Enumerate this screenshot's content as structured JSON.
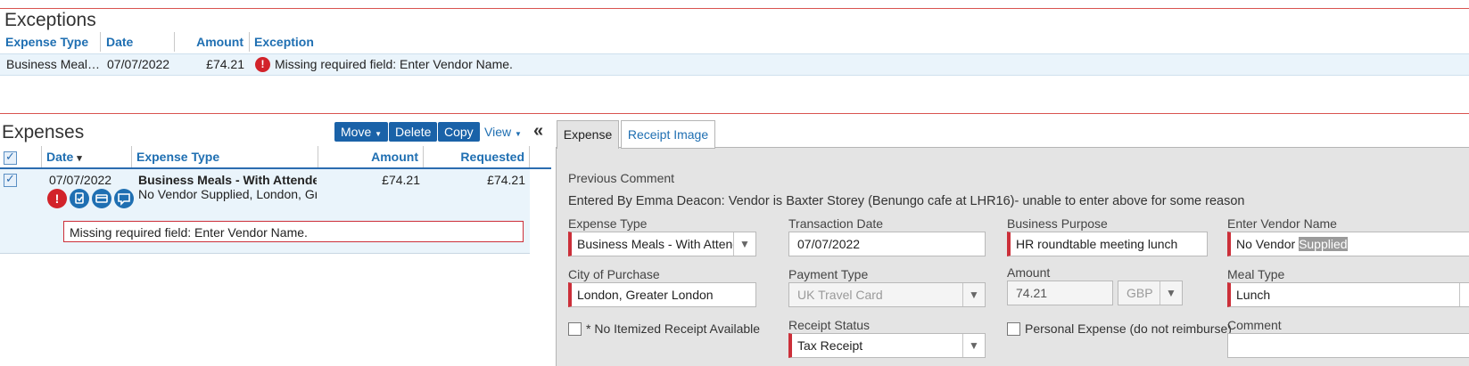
{
  "exceptions": {
    "title": "Exceptions",
    "columns": {
      "expense_type": "Expense Type",
      "date": "Date",
      "amount": "Amount",
      "exception": "Exception"
    },
    "row": {
      "expense_type": "Business Meal…",
      "date": "07/07/2022",
      "amount": "£74.21",
      "exception": "Missing required field: Enter Vendor Name."
    }
  },
  "expenses": {
    "title": "Expenses",
    "buttons": {
      "move": "Move",
      "delete": "Delete",
      "copy": "Copy",
      "view": "View"
    },
    "collapse_glyph": "«",
    "columns": {
      "date": "Date",
      "date_sort": "▾",
      "expense_type": "Expense Type",
      "amount": "Amount",
      "requested": "Requested"
    },
    "row": {
      "date": "07/07/2022",
      "expense_type": "Business Meals - With Attende",
      "details": "No Vendor Supplied, London, Gre",
      "amount": "£74.21",
      "requested": "£74.21",
      "error": "Missing required field: Enter Vendor Name.",
      "icons": [
        "exclamation-icon",
        "receipt-icon",
        "card-icon",
        "comment-icon"
      ]
    }
  },
  "detail": {
    "tabs": {
      "expense": "Expense",
      "receipt_image": "Receipt Image"
    },
    "previous_comment_label": "Previous Comment",
    "previous_comment": "Entered By Emma Deacon: Vendor is Baxter Storey (Benungo cafe at LHR16)- unable to enter above for some reason",
    "fields": {
      "expense_type": {
        "label": "Expense Type",
        "value": "Business Meals - With Attend"
      },
      "transaction_date": {
        "label": "Transaction Date",
        "value": "07/07/2022"
      },
      "business_purpose": {
        "label": "Business Purpose",
        "value": "HR roundtable meeting lunch"
      },
      "vendor_name": {
        "label": "Enter Vendor Name",
        "value": "No Vendor ",
        "value_selected": "Supplied"
      },
      "city": {
        "label": "City of Purchase",
        "value": "London, Greater London"
      },
      "payment_type": {
        "label": "Payment Type",
        "value": "UK Travel Card"
      },
      "amount": {
        "label": "Amount",
        "value": "74.21",
        "currency": "GBP"
      },
      "meal_type": {
        "label": "Meal Type",
        "value": "Lunch"
      },
      "no_receipt": {
        "label": "* No Itemized Receipt Available"
      },
      "receipt_status": {
        "label": "Receipt Status",
        "value": "Tax Receipt"
      },
      "personal_expense": {
        "label": "Personal Expense (do not reimburse)"
      },
      "comment": {
        "label": "Comment"
      }
    }
  },
  "colors": {
    "accent": "#1f6fb2",
    "button": "#1a62a8",
    "required": "#cc2f39",
    "error": "#d2232a"
  }
}
